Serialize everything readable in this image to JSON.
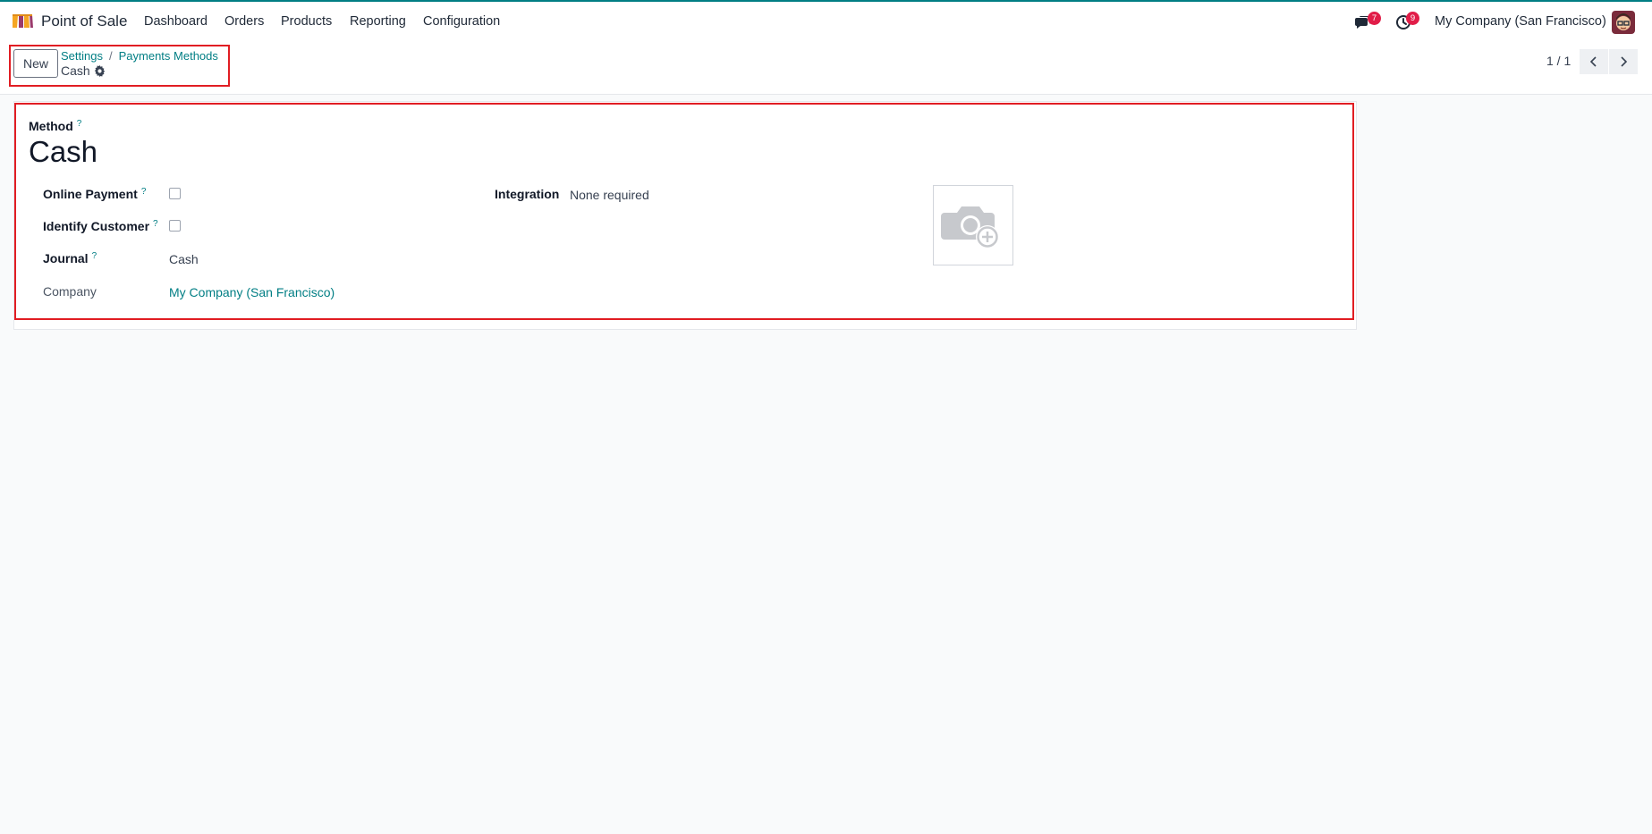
{
  "app": {
    "name": "Point of Sale"
  },
  "nav": {
    "items": [
      {
        "label": "Dashboard"
      },
      {
        "label": "Orders"
      },
      {
        "label": "Products"
      },
      {
        "label": "Reporting"
      },
      {
        "label": "Configuration"
      }
    ]
  },
  "systray": {
    "messages_count": "7",
    "activities_count": "9",
    "company": "My Company (San Francisco)"
  },
  "control_panel": {
    "new_label": "New",
    "breadcrumb": [
      {
        "label": "Settings"
      },
      {
        "label": "Payments Methods"
      }
    ],
    "record_title": "Cash",
    "pager_value": "1 / 1"
  },
  "form": {
    "method_label": "Method",
    "method_value": "Cash",
    "tip": "?",
    "fields": {
      "online_payment": {
        "label": "Online Payment",
        "checked": false
      },
      "identify_customer": {
        "label": "Identify Customer",
        "checked": false
      },
      "journal": {
        "label": "Journal",
        "value": "Cash"
      },
      "company": {
        "label": "Company",
        "value": "My Company (San Francisco)"
      },
      "integration": {
        "label": "Integration",
        "value": "None required"
      }
    }
  },
  "colors": {
    "accent": "#017e84",
    "badge": "#e11d48",
    "highlight": "#e11d23"
  }
}
